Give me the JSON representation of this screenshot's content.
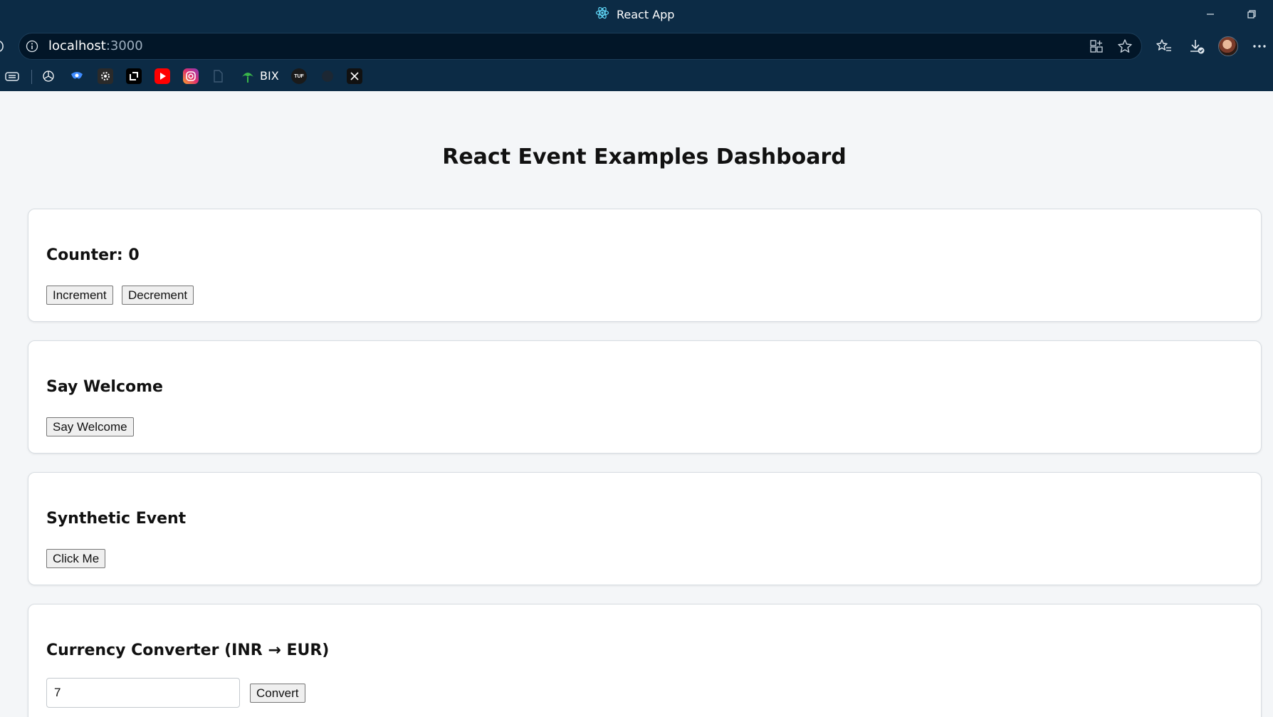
{
  "window": {
    "tab_title": "React App"
  },
  "addressbar": {
    "url_host": "localhost",
    "url_port": ":3000"
  },
  "bookmarks": {
    "label_bix": "BIX",
    "label_tuf": "TUF"
  },
  "page": {
    "title": "React Event Examples Dashboard"
  },
  "counter": {
    "heading": "Counter: 0",
    "increment_label": "Increment",
    "decrement_label": "Decrement"
  },
  "welcome": {
    "heading": "Say Welcome",
    "button_label": "Say Welcome"
  },
  "synthetic": {
    "heading": "Synthetic Event",
    "button_label": "Click Me"
  },
  "converter": {
    "heading": "Currency Converter (INR → EUR)",
    "input_value": "7",
    "button_label": "Convert"
  },
  "colors": {
    "chrome_bg": "#0c2b45",
    "address_bg": "#021628",
    "page_bg": "#f4f6f8",
    "card_bg": "#ffffff"
  }
}
